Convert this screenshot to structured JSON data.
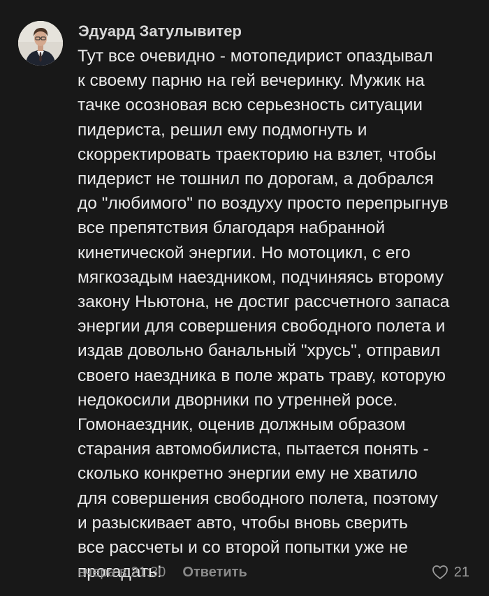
{
  "comment": {
    "author": "Эдуард Затулывитер",
    "lines": [
      "Тут все очевидно - мотопедирист опаздывал",
      "к своему парню на гей вечеринку. Мужик на",
      "тачке осозновая всю серьезность ситуации",
      "пидериста, решил ему подмогнуть и",
      "скорректировать траекторию на взлет, чтобы",
      "пидерист не тошнил по дорогам, а добрался",
      "до \"любимого\" по воздуху просто перепрыгнув",
      "все препятствия благодаря набранной",
      "кинетической энергии. Но мотоцикл, с его",
      "мягкозадым наездником, подчиняясь второму",
      "закону Ньютона, не достиг рассчетного запаса",
      "энергии для совершения свободного полета и",
      "издав довольно банальный \"хрусь\", отправил",
      "своего наездника в поле жрать траву, которую",
      "недокосили дворники по утренней росе.",
      "Гомонаездник,  оценив должным образом",
      "старания автомобилиста, пытается понять -",
      "сколько конкретно энергии ему не хватило",
      "для совершения свободного полета, поэтому",
      "и разыскивает авто, чтобы вновь сверить",
      "все рассчеты и со второй попытки уже не",
      "прогадать!"
    ],
    "timestamp": "вчера в 21:30",
    "reply_label": "Ответить",
    "like_count": "21",
    "like_icon": "heart-outline-icon"
  },
  "colors": {
    "background": "#181818",
    "text": "#eaeaea",
    "muted": "#8a8a8a"
  }
}
